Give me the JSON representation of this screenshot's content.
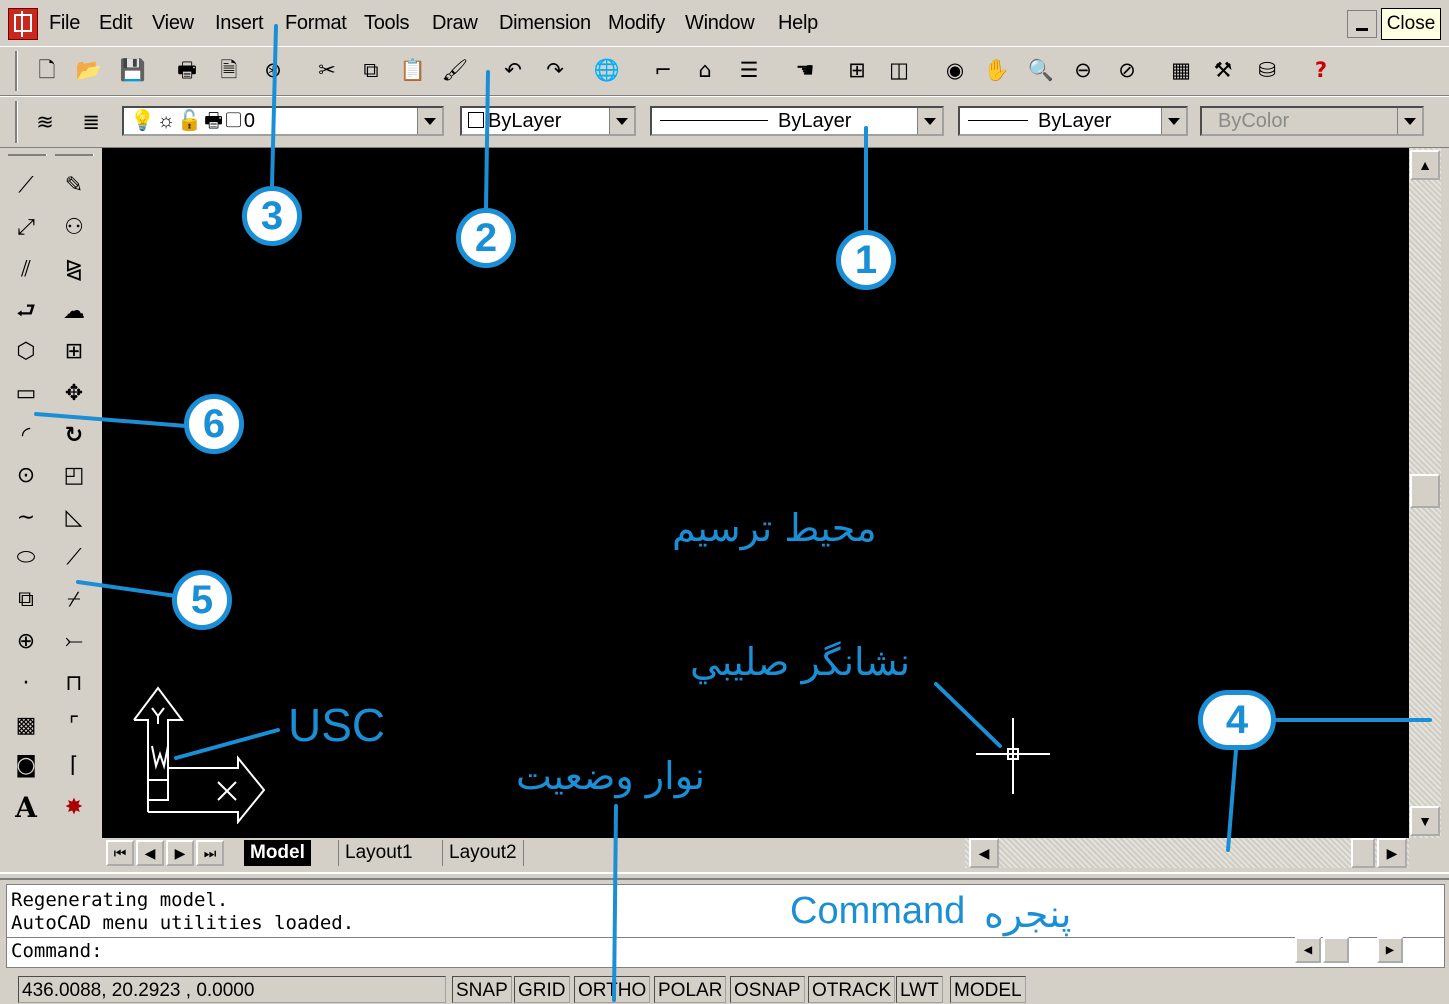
{
  "menu": [
    "File",
    "Edit",
    "View",
    "Insert",
    "Format",
    "Tools",
    "Draw",
    "Dimension",
    "Modify",
    "Window",
    "Help"
  ],
  "close_label": "Close",
  "properties": {
    "layer": "0",
    "color": "ByLayer",
    "linetype": "ByLayer",
    "lineweight": "ByLayer",
    "plotstyle": "ByColor"
  },
  "tabs": [
    "Model",
    "Layout1",
    "Layout2"
  ],
  "command": {
    "lines": [
      "Regenerating model.",
      "AutoCAD menu utilities loaded."
    ],
    "prompt": "Command:"
  },
  "status": {
    "coords": "436.0088, 20.2923 , 0.0000",
    "toggles": [
      "SNAP",
      "GRID",
      "ORTHO",
      "POLAR",
      "OSNAP",
      "OTRACK",
      "LWT",
      "MODEL"
    ]
  },
  "annotations": {
    "callouts": [
      "1",
      "2",
      "3",
      "4",
      "5",
      "6"
    ],
    "ucs": "USC",
    "drawing_area": "محیط ترسیم",
    "crosshair": "نشانگر صلیبي",
    "status_bar": "نوار وضعیت",
    "command_window": "Command",
    "command_window_fa": "پنجره"
  },
  "colors": {
    "accent": "#1b8fd6",
    "canvas": "#000000",
    "chrome": "#d4d0c8"
  }
}
